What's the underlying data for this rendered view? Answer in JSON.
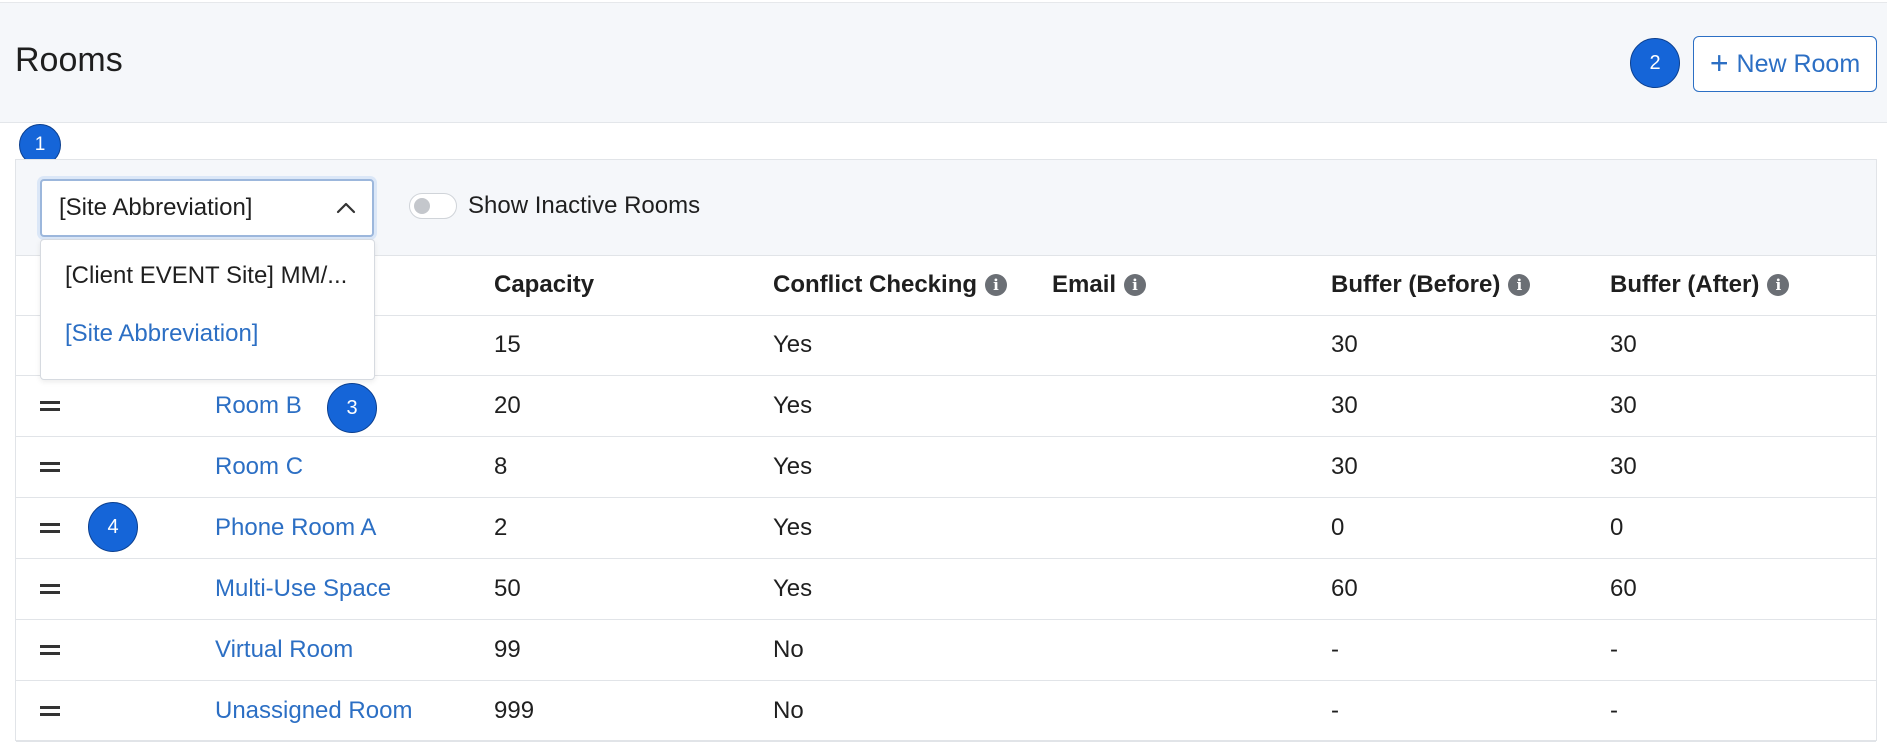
{
  "header": {
    "title": "Rooms",
    "new_room_icon": "+",
    "new_room_label": "New Room"
  },
  "badges": [
    "1",
    "2",
    "3",
    "4"
  ],
  "filters": {
    "site_select_value": "[Site Abbreviation]",
    "site_options": [
      "[Client EVENT Site] MM/...",
      "[Site Abbreviation]"
    ],
    "show_inactive_label": "Show Inactive Rooms",
    "show_inactive_on": false
  },
  "table": {
    "columns": {
      "capacity": "Capacity",
      "conflict": "Conflict Checking",
      "email": "Email",
      "buffer_before": "Buffer (Before)",
      "buffer_after": "Buffer (After)"
    },
    "info_icon_glyph": "i",
    "rows": [
      {
        "name": "",
        "capacity": "15",
        "conflict": "Yes",
        "email": "",
        "buffer_before": "30",
        "buffer_after": "30"
      },
      {
        "name": "Room B",
        "capacity": "20",
        "conflict": "Yes",
        "email": "",
        "buffer_before": "30",
        "buffer_after": "30"
      },
      {
        "name": "Room C",
        "capacity": "8",
        "conflict": "Yes",
        "email": "",
        "buffer_before": "30",
        "buffer_after": "30"
      },
      {
        "name": "Phone Room A",
        "capacity": "2",
        "conflict": "Yes",
        "email": "",
        "buffer_before": "0",
        "buffer_after": "0"
      },
      {
        "name": "Multi-Use Space",
        "capacity": "50",
        "conflict": "Yes",
        "email": "",
        "buffer_before": "60",
        "buffer_after": "60"
      },
      {
        "name": "Virtual Room",
        "capacity": "99",
        "conflict": "No",
        "email": "",
        "buffer_before": "-",
        "buffer_after": "-"
      },
      {
        "name": "Unassigned Room",
        "capacity": "999",
        "conflict": "No",
        "email": "",
        "buffer_before": "-",
        "buffer_after": "-"
      }
    ]
  },
  "colors": {
    "accent": "#2c6fc4",
    "badge": "#1565d8",
    "header_bg": "#f5f7fa"
  }
}
